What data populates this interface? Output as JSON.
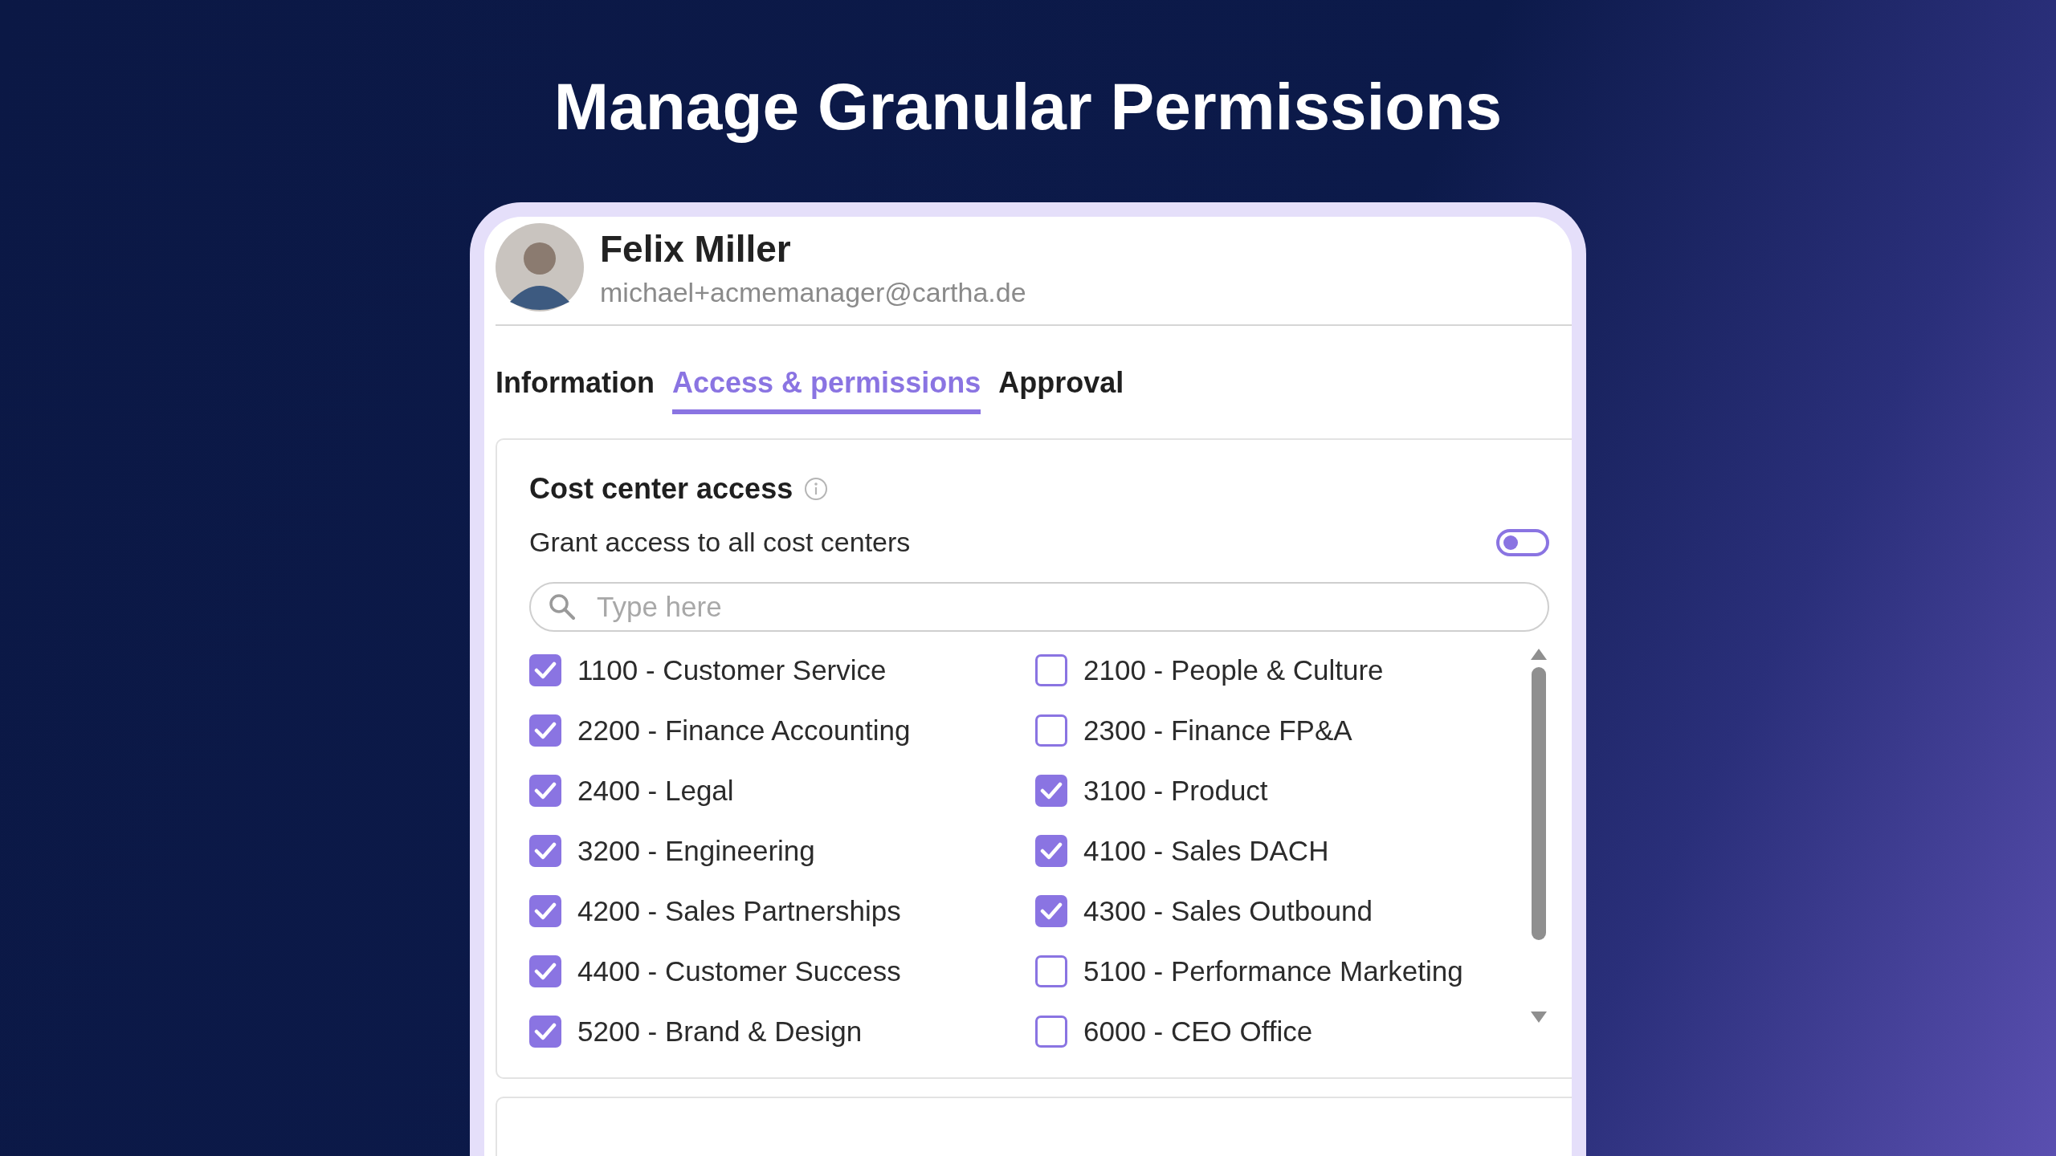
{
  "headline": "Manage Granular Permissions",
  "user": {
    "name": "Felix Miller",
    "email": "michael+acmemanager@cartha.de"
  },
  "tabs": [
    {
      "label": "Information",
      "selected": false
    },
    {
      "label": "Access & permissions",
      "selected": true
    },
    {
      "label": "Approval",
      "selected": false
    }
  ],
  "cost_center": {
    "title": "Cost center access",
    "toggle_label": "Grant access to all cost centers",
    "toggle_on": false,
    "search": {
      "placeholder": "Type here"
    },
    "items": [
      {
        "label": "1100 - Customer Service",
        "checked": true
      },
      {
        "label": "2100 - People & Culture",
        "checked": false
      },
      {
        "label": "2200 - Finance Accounting",
        "checked": true
      },
      {
        "label": "2300 - Finance FP&A",
        "checked": false
      },
      {
        "label": "2400 - Legal",
        "checked": true
      },
      {
        "label": "3100 - Product",
        "checked": true
      },
      {
        "label": "3200 - Engineering",
        "checked": true
      },
      {
        "label": "4100 - Sales DACH",
        "checked": true
      },
      {
        "label": "4200 - Sales Partnerships",
        "checked": true
      },
      {
        "label": "4300 - Sales Outbound",
        "checked": true
      },
      {
        "label": "4400 - Customer Success",
        "checked": true
      },
      {
        "label": "5100 - Performance Marketing",
        "checked": false
      },
      {
        "label": "5200 - Brand & Design",
        "checked": true
      },
      {
        "label": "6000 - CEO Office",
        "checked": false
      }
    ]
  }
}
